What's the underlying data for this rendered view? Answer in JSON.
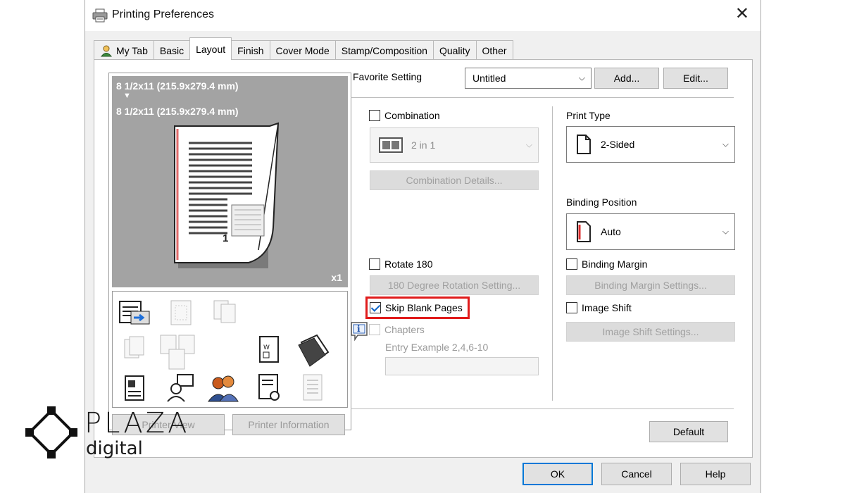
{
  "title": "Printing Preferences",
  "tabs": [
    "My Tab",
    "Basic",
    "Layout",
    "Finish",
    "Cover Mode",
    "Stamp/Composition",
    "Quality",
    "Other"
  ],
  "active_tab": "Layout",
  "preview": {
    "paper_line1": "8 1/2x11 (215.9x279.4 mm)",
    "arrow": "▼",
    "paper_line2": "8 1/2x11 (215.9x279.4 mm)",
    "copies": "x1",
    "page_number": "1"
  },
  "buttons": {
    "printer_view": "Printer View",
    "printer_information": "Printer Information",
    "add": "Add...",
    "edit": "Edit...",
    "combination_details": "Combination Details...",
    "rotation_setting": "180 Degree Rotation Setting...",
    "binding_margin_settings": "Binding Margin Settings...",
    "image_shift_settings": "Image Shift Settings...",
    "default": "Default",
    "ok": "OK",
    "cancel": "Cancel",
    "help": "Help"
  },
  "favorite": {
    "label": "Favorite Setting",
    "value": "Untitled"
  },
  "combination": {
    "label": "Combination",
    "checked": false,
    "value": "2 in 1"
  },
  "rotate": {
    "label": "Rotate 180",
    "checked": false
  },
  "skip_blank": {
    "label": "Skip Blank Pages",
    "checked": true
  },
  "chapters": {
    "label": "Chapters",
    "entry_label": "Entry Example 2,4,6-10",
    "value": ""
  },
  "print_type": {
    "label": "Print Type",
    "value": "2-Sided"
  },
  "binding_position": {
    "label": "Binding Position",
    "value": "Auto"
  },
  "binding_margin": {
    "label": "Binding Margin",
    "checked": false
  },
  "image_shift": {
    "label": "Image Shift",
    "checked": false
  },
  "watermark": {
    "line1": "PLAZA",
    "line2": "digital"
  },
  "colors": {
    "highlight": "#e01b1b",
    "accent": "#0078d7"
  }
}
